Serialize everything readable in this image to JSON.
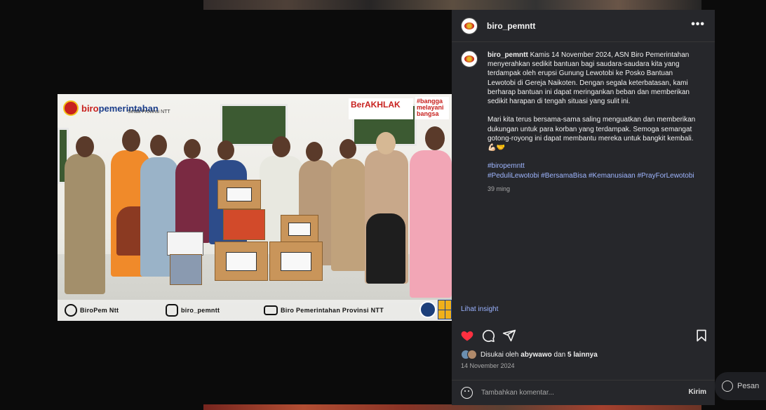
{
  "post": {
    "username": "biro_pemntt",
    "caption": {
      "username": "biro_pemntt",
      "paragraph1": "Kamis 14 November 2024, ASN Biro Pemerintahan menyerahkan sedikit bantuan bagi saudara-saudara kita yang terdampak oleh erupsi Gunung Lewotobi ke Posko Bantuan Lewotobi di Gereja Naikoten. Dengan segala keterbatasan, kami berharap bantuan ini dapat meringankan beban dan memberikan sedikit harapan di tengah situasi yang sulit ini.",
      "paragraph2": "Mari kita terus bersama-sama saling menguatkan dan memberikan dukungan untuk para korban yang terdampak. Semoga semangat gotong-royong ini dapat membantu mereka untuk bangkit kembali. 💪🏻🤝",
      "hashtags_line1": "#biropemntt",
      "hashtags_line2": "#PeduliLewotobi #BersamaBisa #Kemanusiaan #PrayForLewotobi",
      "time_ago": "39 ming"
    },
    "insight_link": "Lihat insight",
    "likes": {
      "prefix": "Disukai oleh",
      "user": "abywawo",
      "connector": "dan",
      "others": "5 lainnya"
    },
    "date": "14 November 2024",
    "comment": {
      "placeholder": "Tambahkan komentar...",
      "send_label": "Kirim"
    },
    "image": {
      "brand_left_a": "biro",
      "brand_left_b": "pemerintahan",
      "brand_left_sub": "Setda Provinsi NTT",
      "badge_akhlak": "BerAKHLAK",
      "badge_bangga": "#bangga melayani bangsa",
      "footer_fb": "BiroPem Ntt",
      "footer_ig": "biro_pemntt",
      "footer_yt": "Biro Pemerintahan Provinsi NTT"
    }
  },
  "messages": {
    "label": "Pesan"
  },
  "icons": {
    "like": "heart-icon",
    "comment": "comment-icon",
    "share": "send-icon",
    "save": "bookmark-icon",
    "more": "more-options-icon",
    "emoji": "emoji-icon",
    "messages": "messenger-icon"
  },
  "colors": {
    "like_red": "#ff3040",
    "link_blue": "#9ab2ff",
    "panel_bg": "#26272b"
  }
}
